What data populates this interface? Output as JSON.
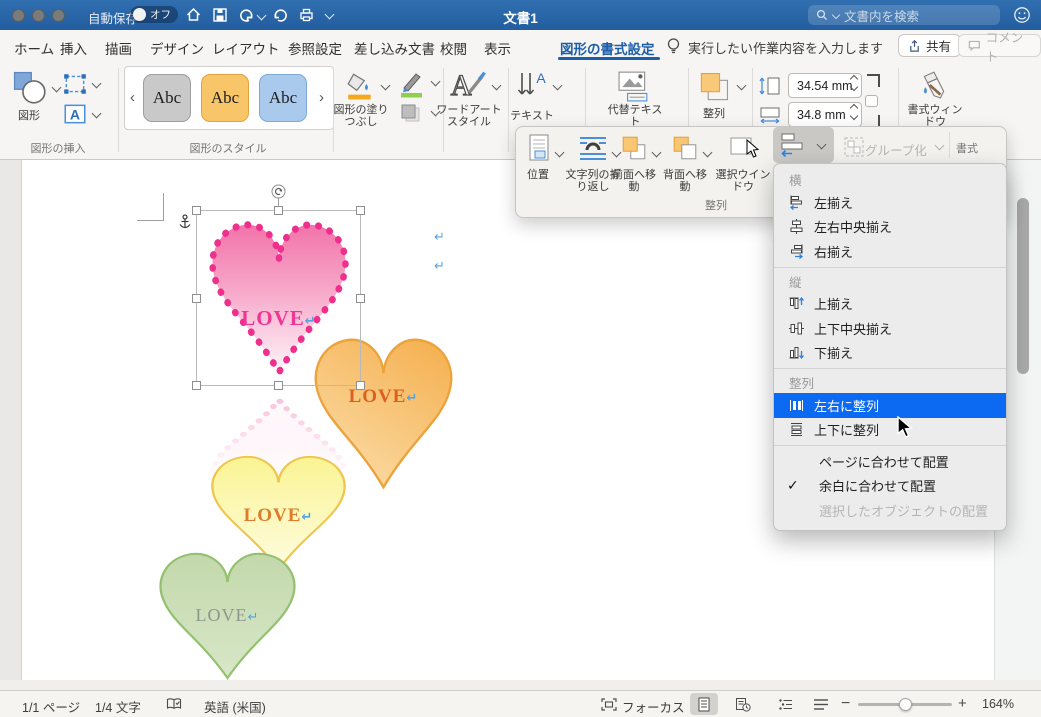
{
  "titlebar": {
    "autosave_label": "自動保存",
    "autosave_state": "オフ",
    "title": "文書1",
    "search_placeholder": "文書内を検索"
  },
  "tabs": {
    "items": [
      "ホーム",
      "挿入",
      "描画",
      "デザイン",
      "レイアウト",
      "参照設定",
      "差し込み文書",
      "校閲",
      "表示",
      "図形の書式設定"
    ],
    "tell_me": "実行したい作業内容を入力します",
    "share": "共有",
    "comment": "コメント"
  },
  "ribbon": {
    "shapes": "図形",
    "group_insert_shapes": "図形の挿入",
    "group_shape_styles": "図形のスタイル",
    "style_chips": [
      "Abc",
      "Abc",
      "Abc"
    ],
    "shape_fill": "図形の塗りつぶし",
    "wordart": "ワードアートスタイル",
    "text": "テキスト",
    "alt_text": "代替テキスト",
    "arrange": "整列",
    "size_height": "34.54 mm",
    "size_width": "34.8 mm",
    "format_pane": "書式ウィンドウ",
    "group_format": "書式"
  },
  "overlay": {
    "position": "位置",
    "wrap": "文字列の折り返し",
    "bring_front": "前面へ移動",
    "send_back": "背面へ移動",
    "selection_pane": "選択ウインドウ",
    "group": "グループ化",
    "group_label": "整列",
    "format_label": "書式"
  },
  "menu": {
    "sections": [
      {
        "header": "横",
        "items": [
          "左揃え",
          "左右中央揃え",
          "右揃え"
        ]
      },
      {
        "header": "縦",
        "items": [
          "上揃え",
          "上下中央揃え",
          "下揃え"
        ]
      },
      {
        "header": "整列",
        "items": [
          "左右に整列",
          "上下に整列"
        ],
        "selected": "左右に整列"
      }
    ],
    "footer": [
      "ページに合わせて配置",
      "余白に合わせて配置",
      "選択したオブジェクトの配置"
    ],
    "checked_item": "余白に合わせて配置",
    "disabled_item": "選択したオブジェクトの配置"
  },
  "document": {
    "hearts": [
      {
        "name": "pink",
        "text": "LOVE",
        "text_color": "#ef3694",
        "border": "#ee2f8b"
      },
      {
        "name": "orange",
        "text": "LOVE",
        "text_color": "#dd5f1f",
        "border": "#eca33c"
      },
      {
        "name": "yellow",
        "text": "LOVE",
        "text_color": "#df7b2c",
        "border": "#eec54d"
      },
      {
        "name": "green",
        "text": "LOVE",
        "text_color": "#8f948f",
        "border": "#94c170"
      }
    ],
    "return_mark": "↵"
  },
  "statusbar": {
    "page": "1/1 ページ",
    "chars": "1/4 文字",
    "language": "英語 (米国)",
    "focus": "フォーカス",
    "zoom": "164%"
  }
}
